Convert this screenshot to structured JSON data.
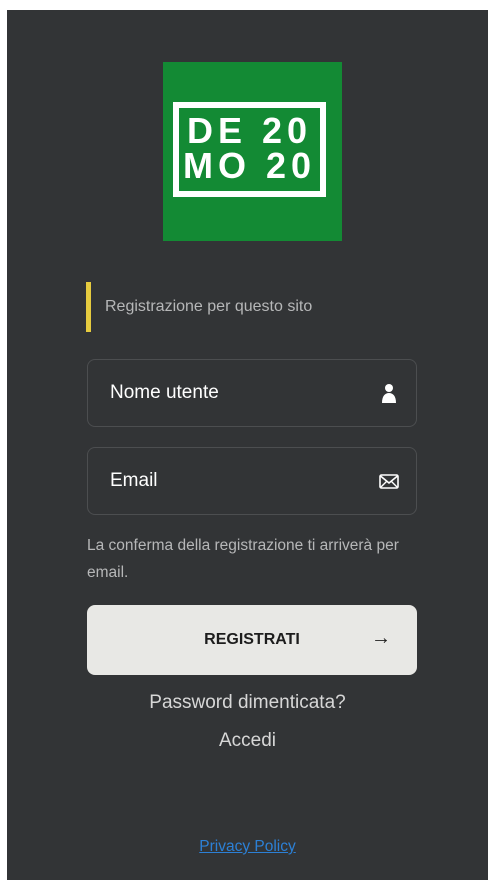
{
  "logo": {
    "line1": "DE 20",
    "line2": "MO 20",
    "background_color": "#138a34"
  },
  "notice": {
    "text": "Registrazione per questo sito",
    "accent_color": "#e6cb3f"
  },
  "form": {
    "username": {
      "placeholder": "Nome utente",
      "value": "",
      "icon": "user-icon"
    },
    "email": {
      "placeholder": "Email",
      "value": "",
      "icon": "envelope-icon"
    },
    "hint": "La conferma della registrazione ti arriverà per email.",
    "submit_label": "REGISTRATI",
    "submit_arrow": "→"
  },
  "links": {
    "forgot_password": "Password dimenticata?",
    "login": "Accedi",
    "privacy": "Privacy Policy"
  },
  "colors": {
    "background": "#323436",
    "button_bg": "#e8e8e5",
    "link": "#2c80d6"
  }
}
